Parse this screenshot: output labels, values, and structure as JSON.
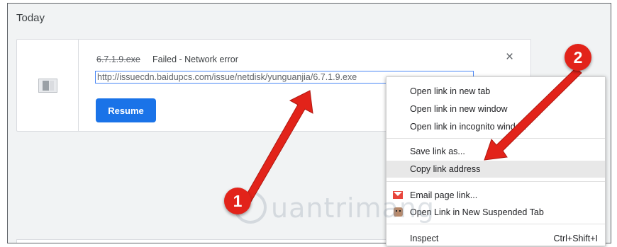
{
  "section": {
    "title": "Today"
  },
  "download": {
    "file_name": "6.7.1.9.exe",
    "status": "Failed - Network error",
    "url": "http://issuecdn.baidupcs.com/issue/netdisk/yunguanjia/6.7.1.9.exe",
    "resume_label": "Resume",
    "close_glyph": "×"
  },
  "context_menu": {
    "items": [
      {
        "label": "Open link in new tab"
      },
      {
        "label": "Open link in new window"
      },
      {
        "label": "Open link in incognito window"
      },
      {
        "label": "Save link as..."
      },
      {
        "label": "Copy link address",
        "highlighted": true
      },
      {
        "label": "Email page link...",
        "icon": "mail-icon"
      },
      {
        "label": "Open Link in New Suspended Tab",
        "icon": "suspend-icon"
      },
      {
        "label": "Inspect",
        "shortcut": "Ctrl+Shift+I"
      }
    ]
  },
  "annotations": {
    "badge_1": "1",
    "badge_2": "2",
    "color": "#e2231a"
  },
  "watermark": {
    "text": "uantrimang"
  }
}
